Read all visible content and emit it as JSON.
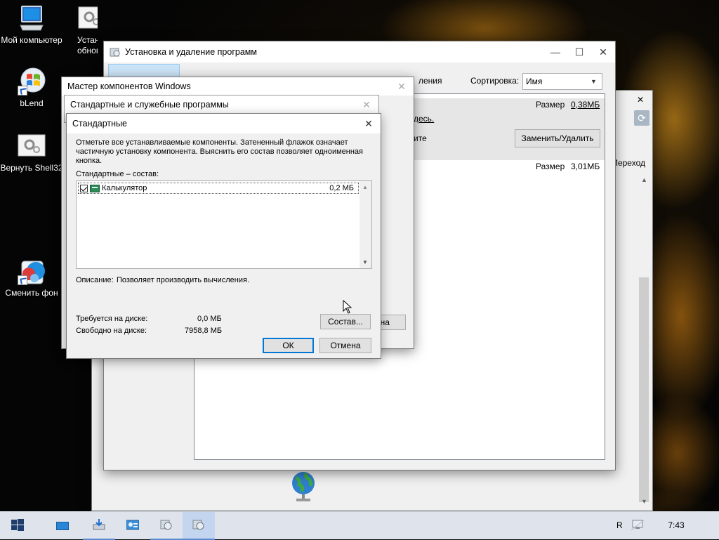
{
  "desktop": {
    "icons": [
      {
        "label": "Мой компьютер"
      },
      {
        "label": "Устано обновл"
      },
      {
        "label": "bLend"
      },
      {
        "label": "Вернуть Shell32"
      },
      {
        "label": "Сменить фон"
      }
    ]
  },
  "arp_window": {
    "title": "Установка и удаление программ",
    "partial_header": "ления",
    "sort_label": "Сортировка:",
    "sort_value": "Имя",
    "size_label_1": "Размер",
    "size_value_1": "0,38МБ",
    "link_text": "десь.",
    "partial_text": "ите",
    "replace_button": "Заменить/Удалить",
    "size_label_2": "Размер",
    "size_value_2": "3,01МБ",
    "behind_cancel_partial": "ена"
  },
  "back_window": {
    "partial_nav": "Переход"
  },
  "wizard": {
    "title": "Мастер компонентов Windows"
  },
  "std_services": {
    "title": "Стандартные и служебные программы"
  },
  "std_dialog": {
    "title": "Стандартные",
    "instructions": "Отметьте все устанавливаемые компоненты. Затененный флажок означает частичную установку компонента. Выяснить его состав позволяет одноименная кнопка.",
    "list_label": "Стандартные – состав:",
    "components": [
      {
        "name": "Калькулятор",
        "size": "0,2 МБ",
        "checked": true
      }
    ],
    "description_label": "Описание:",
    "description_text": "Позволяет производить вычисления.",
    "disk_required_label": "Требуется на диске:",
    "disk_required_value": "0,0 МБ",
    "disk_free_label": "Свободно на диске:",
    "disk_free_value": "7958,8 МБ",
    "details_button": "Состав...",
    "ok_button": "ОК",
    "cancel_button": "Отмена"
  },
  "taskbar": {
    "tray_partial": "R",
    "clock": "7:43"
  },
  "colors": {
    "accent": "#0078d7",
    "selection": "#cce4f7",
    "taskbar": "#dfe4ec"
  }
}
